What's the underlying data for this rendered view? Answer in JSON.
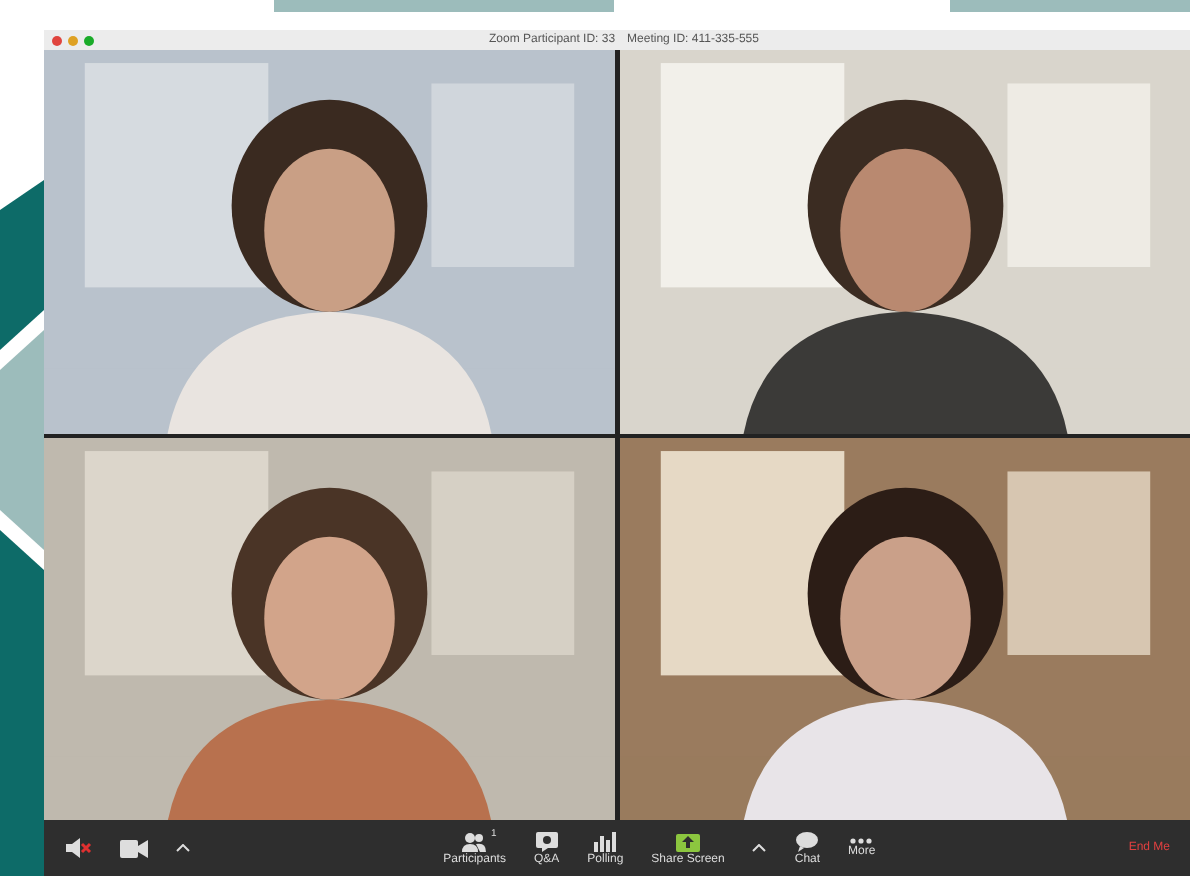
{
  "window": {
    "title_parts": [
      "Zoom Participant ID: 33",
      "Meeting ID: 411-335-555"
    ]
  },
  "toolbar": {
    "left": [
      {
        "kind": "mic",
        "muted": true
      },
      {
        "kind": "video"
      },
      {
        "kind": "caret"
      }
    ],
    "center": [
      {
        "kind": "participants",
        "label": "Participants",
        "count": "1"
      },
      {
        "kind": "qa",
        "label": "Q&A"
      },
      {
        "kind": "polling",
        "label": "Polling"
      },
      {
        "kind": "share",
        "label": "Share Screen"
      },
      {
        "kind": "caret"
      },
      {
        "kind": "chat",
        "label": "Chat"
      },
      {
        "kind": "more",
        "label": "More"
      }
    ],
    "end": "End Me"
  }
}
